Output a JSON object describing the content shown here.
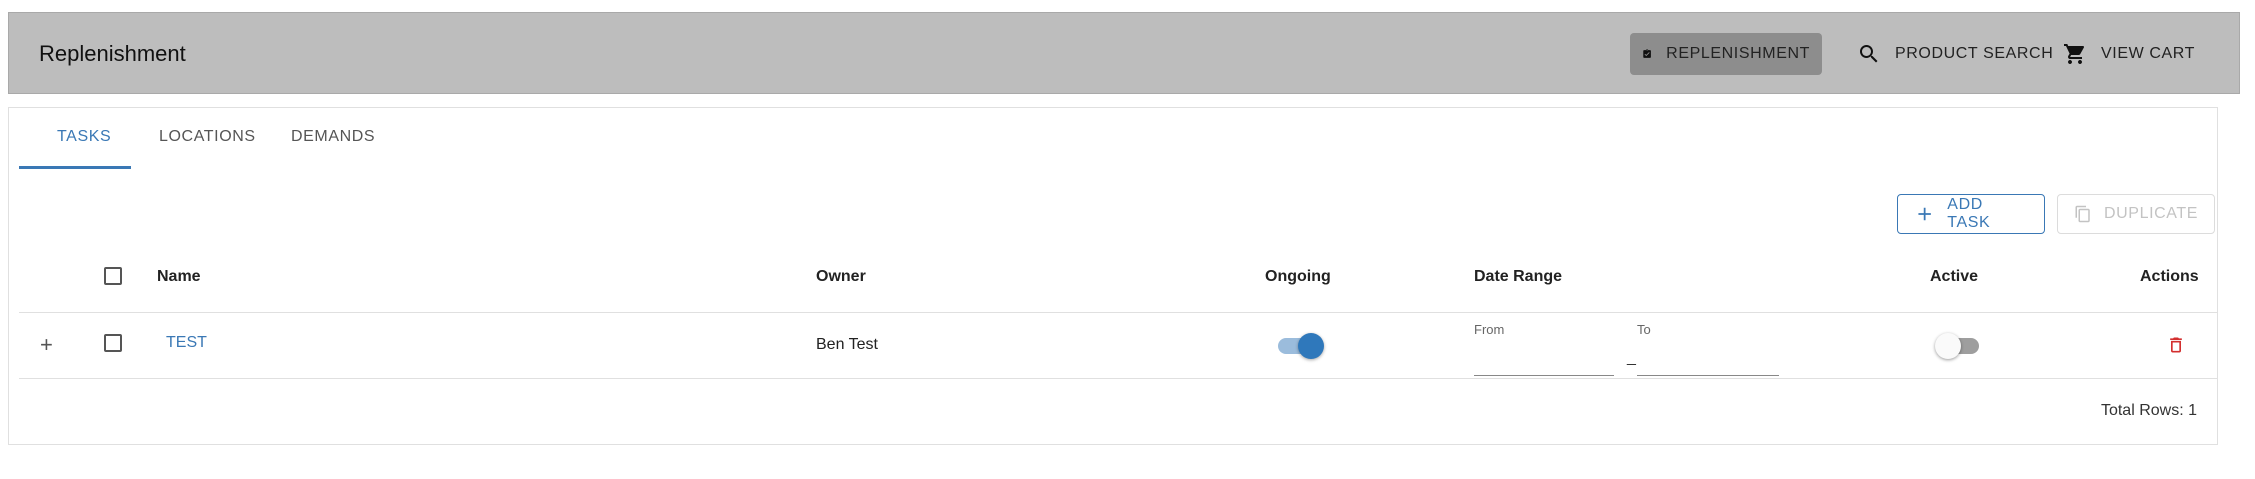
{
  "app": {
    "title": "Replenishment"
  },
  "nav": {
    "replenishment": {
      "label": "REPLENISHMENT",
      "icon": "clipboard-check-icon"
    },
    "product_search": {
      "label": "PRODUCT SEARCH",
      "icon": "search-icon"
    },
    "view_cart": {
      "label": "VIEW CART",
      "icon": "cart-icon"
    }
  },
  "tabs": [
    {
      "label": "TASKS",
      "active": true
    },
    {
      "label": "LOCATIONS",
      "active": false
    },
    {
      "label": "DEMANDS",
      "active": false
    }
  ],
  "toolbar": {
    "add_task": "ADD TASK",
    "duplicate": "DUPLICATE"
  },
  "table": {
    "columns": {
      "name": "Name",
      "owner": "Owner",
      "ongoing": "Ongoing",
      "date_range": "Date Range",
      "active": "Active",
      "actions": "Actions"
    },
    "rows": [
      {
        "expand": "+",
        "name": "TEST",
        "owner": "Ben Test",
        "ongoing": true,
        "date_from_label": "From",
        "date_to_label": "To",
        "date_separator": "_",
        "active": false
      }
    ],
    "total_rows": "Total Rows: 1"
  },
  "colors": {
    "accent": "#3a78b5",
    "appbar": "#bdbdbd",
    "delete": "#d32f2f"
  }
}
